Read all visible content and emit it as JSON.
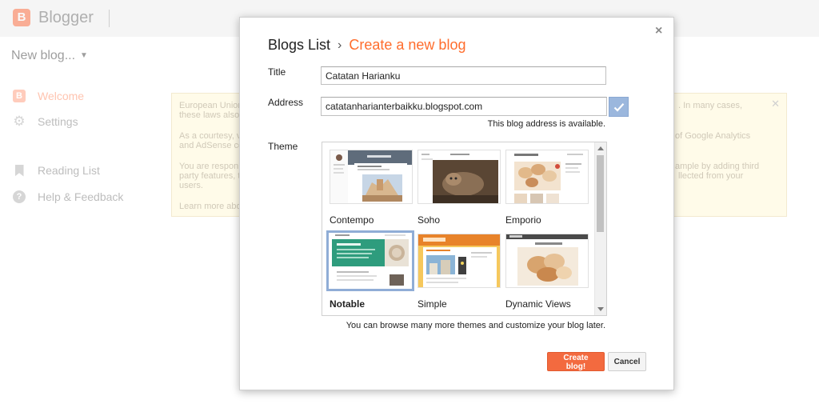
{
  "app": {
    "brand": "Blogger",
    "blog_selector": "New blog..."
  },
  "sidebar": {
    "items": [
      {
        "label": "Welcome",
        "icon": "blogger-icon",
        "active": true
      },
      {
        "label": "Settings",
        "icon": "gear-icon"
      },
      {
        "label": "Reading List",
        "icon": "bookmark-icon"
      },
      {
        "label": "Help & Feedback",
        "icon": "help-icon"
      }
    ]
  },
  "notice": {
    "fragments": [
      "European Union",
      "these laws also",
      ". In many cases,",
      "As a courtesy, v",
      "and AdSense co",
      "of Google Analytics",
      "You are respon",
      "party features, t",
      "users.",
      "ample by adding third",
      "llected from your",
      "Learn more abo"
    ]
  },
  "dialog": {
    "breadcrumb_root": "Blogs List",
    "breadcrumb_sep": "›",
    "breadcrumb_current": "Create a new blog",
    "title_label": "Title",
    "title_value": "Catatan Harianku",
    "address_label": "Address",
    "address_value": "catatanharianterbaikku.blogspot.com",
    "address_status": "This blog address is available.",
    "theme_label": "Theme",
    "themes": [
      {
        "name": "Contempo"
      },
      {
        "name": "Soho"
      },
      {
        "name": "Emporio"
      },
      {
        "name": "Notable",
        "selected": true
      },
      {
        "name": "Simple"
      },
      {
        "name": "Dynamic Views"
      }
    ],
    "theme_hint": "You can browse many more themes and customize your blog later.",
    "create_label": "Create blog!",
    "cancel_label": "Cancel",
    "close_glyph": "×"
  },
  "colors": {
    "accent": "#ff6d2d",
    "primary_button": "#f36a3f",
    "selected_border": "#90add6",
    "check_button": "#9bb7dd"
  }
}
